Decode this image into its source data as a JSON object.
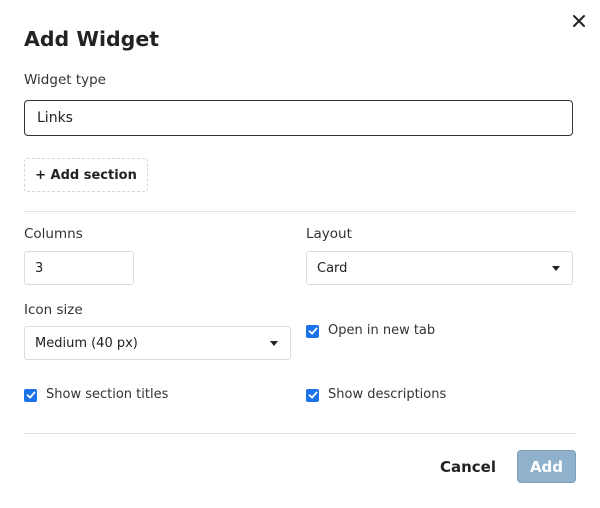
{
  "dialog": {
    "title": "Add Widget",
    "close_icon": "close-icon"
  },
  "widget_type": {
    "label": "Widget type",
    "value": "Links"
  },
  "add_section": {
    "label": "+ Add section"
  },
  "columns": {
    "label": "Columns",
    "value": "3"
  },
  "layout": {
    "label": "Layout",
    "selected": "Card",
    "icon": "chevron-down-icon"
  },
  "icon_size": {
    "label": "Icon size",
    "selected": "Medium (40 px)",
    "icon": "chevron-down-icon"
  },
  "options": {
    "open_in_new_tab": {
      "label": "Open in new tab",
      "checked": true
    },
    "show_section_titles": {
      "label": "Show section titles",
      "checked": true
    },
    "show_descriptions": {
      "label": "Show descriptions",
      "checked": true
    }
  },
  "footer": {
    "cancel_label": "Cancel",
    "add_label": "Add",
    "add_disabled": true
  },
  "colors": {
    "checkbox_accent": "#1a73e8",
    "add_button_disabled": "#8fb1cb",
    "text": "#222222"
  }
}
